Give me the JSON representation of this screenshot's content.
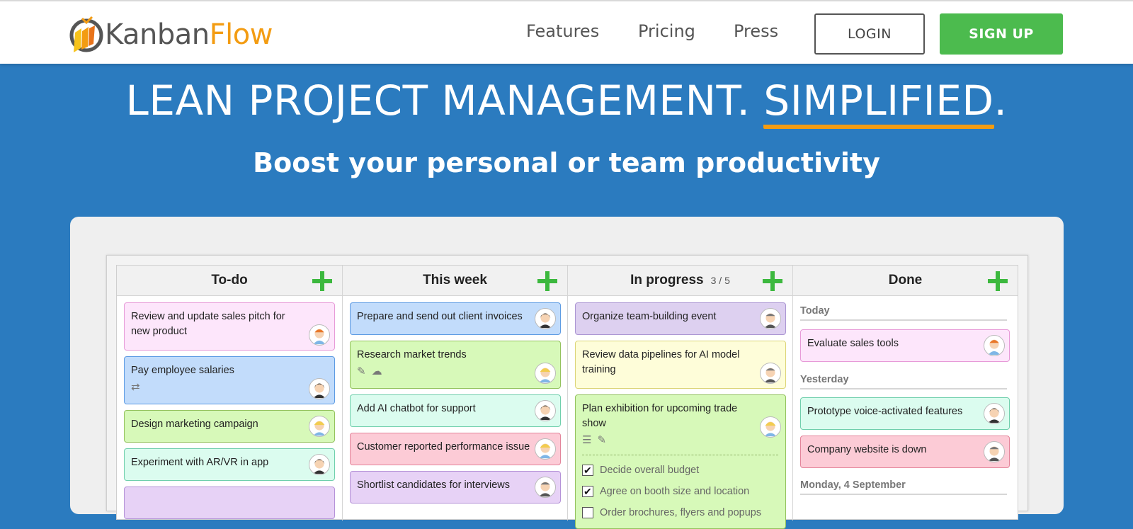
{
  "header": {
    "logo_part1": "Kanban",
    "logo_part2": "Flow",
    "nav": [
      "Features",
      "Pricing",
      "Press"
    ],
    "login_label": "LOGIN",
    "signup_label": "SIGN UP"
  },
  "hero": {
    "title_main": "LEAN PROJECT MANAGEMENT. ",
    "title_highlight": "SIMPLIFIED",
    "title_end": ".",
    "subtitle": "Boost your personal or team productivity"
  },
  "colors": {
    "brand_blue": "#2b7bbf",
    "accent_orange": "#f39c12",
    "signup_green": "#4cbb4e"
  },
  "board": {
    "columns": [
      {
        "title": "To-do",
        "limit": "",
        "cards": [
          {
            "text": "Review and update sales pitch for new product",
            "color": "pink",
            "icons": []
          },
          {
            "text": "Pay employee salaries",
            "color": "blue",
            "icons": [
              "repeat-icon"
            ]
          },
          {
            "text": "Design marketing campaign",
            "color": "lgreen",
            "icons": []
          },
          {
            "text": "Experiment with AR/VR in app",
            "color": "mint",
            "icons": []
          }
        ]
      },
      {
        "title": "This week",
        "limit": "",
        "cards": [
          {
            "text": "Prepare and send out client invoices",
            "color": "blue",
            "icons": []
          },
          {
            "text": "Research market trends",
            "color": "lgreen",
            "icons": [
              "attachment-icon",
              "comment-icon"
            ]
          },
          {
            "text": "Add AI chatbot for support",
            "color": "mint",
            "icons": []
          },
          {
            "text": "Customer reported performance issue",
            "color": "red",
            "icons": []
          },
          {
            "text": "Shortlist candidates for interviews",
            "color": "purple",
            "icons": []
          }
        ]
      },
      {
        "title": "In progress",
        "limit": "3 / 5",
        "cards": [
          {
            "text": "Organize team-building event",
            "color": "grey-p",
            "icons": []
          },
          {
            "text": "Review data pipelines for AI model training",
            "color": "yellow",
            "icons": []
          },
          {
            "text": "Plan exhibition for upcoming trade show",
            "color": "lgreen",
            "icons": [
              "checklist-icon",
              "attachment-icon"
            ],
            "subtasks": [
              {
                "text": "Decide overall budget",
                "done": true
              },
              {
                "text": "Agree on booth size and location",
                "done": true
              },
              {
                "text": "Order brochures, flyers and popups",
                "done": false
              }
            ]
          }
        ]
      },
      {
        "title": "Done",
        "limit": "",
        "groups": [
          {
            "label": "Today",
            "cards": [
              {
                "text": "Evaluate sales tools",
                "color": "pink"
              }
            ]
          },
          {
            "label": "Yesterday",
            "cards": [
              {
                "text": "Prototype voice-activated features",
                "color": "mint"
              },
              {
                "text": "Company website is down",
                "color": "red"
              }
            ]
          },
          {
            "label": "Monday, 4 September",
            "cards": []
          }
        ]
      }
    ]
  }
}
